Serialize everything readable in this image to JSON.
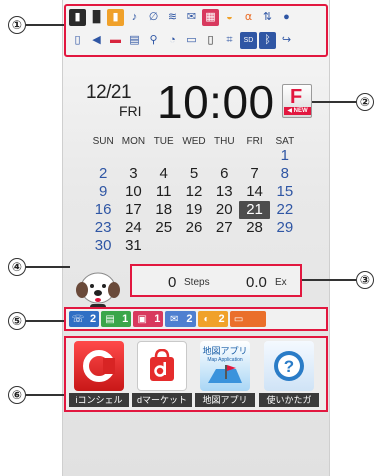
{
  "callouts": [
    "①",
    "②",
    "③",
    "④",
    "⑤",
    "⑥"
  ],
  "status_icons_row1": [
    "signal-icon",
    "antenna-icon",
    "battery-icon",
    "vibrate-icon",
    "silent-icon",
    "wifi-icon",
    "mail-icon",
    "calendar-icon",
    "omakase-lock-icon",
    "alarm-icon",
    "sync-icon",
    "bubble-icon"
  ],
  "status_icons_row2": [
    "sim-icon",
    "speaker-icon",
    "car-icon",
    "keyboard-icon",
    "walk-icon",
    "timer-icon",
    "card-icon",
    "battery-low-icon",
    "ir-icon",
    "sd-icon",
    "bluetooth-icon",
    "call-forward-icon"
  ],
  "clock": {
    "date": "12/21",
    "day": "FRI",
    "time": "10:00"
  },
  "f_badge": {
    "letter": "F",
    "new_label": "NEW"
  },
  "calendar": {
    "weekdays": [
      "SUN",
      "MON",
      "TUE",
      "WED",
      "THU",
      "FRI",
      "SAT"
    ],
    "weeks": [
      [
        "",
        "",
        "",
        "",
        "",
        "",
        "1"
      ],
      [
        "2",
        "3",
        "4",
        "5",
        "6",
        "7",
        "8"
      ],
      [
        "9",
        "10",
        "11",
        "12",
        "13",
        "14",
        "15"
      ],
      [
        "16",
        "17",
        "18",
        "19",
        "20",
        "21",
        "22"
      ],
      [
        "23",
        "24",
        "25",
        "26",
        "27",
        "28",
        "29"
      ],
      [
        "30",
        "31",
        "",
        "",
        "",
        "",
        ""
      ]
    ],
    "today": "21"
  },
  "steps": {
    "count": "0",
    "count_unit": "Steps",
    "ex": "0.0",
    "ex_unit": "Ex"
  },
  "notifications": [
    {
      "icon": "missed-call-icon",
      "count": "2",
      "color": "#2f6fc4"
    },
    {
      "icon": "voicemail-icon",
      "count": "1",
      "color": "#3aa64a"
    },
    {
      "icon": "sms-icon",
      "count": "1",
      "color": "#d8395e"
    },
    {
      "icon": "mail-icon",
      "count": "2",
      "color": "#4f7fd0"
    },
    {
      "icon": "news-icon",
      "count": "2",
      "color": "#f0a12a"
    },
    {
      "icon": "message-icon",
      "count": "",
      "color": "#ea6f2a"
    }
  ],
  "apps": [
    {
      "name": "iconcier-icon",
      "label": "iコンシェル",
      "color": "#e52c2c"
    },
    {
      "name": "dmarket-icon",
      "label": "dマーケット",
      "color": "#e52c2c"
    },
    {
      "name": "map-app-icon",
      "label": "地図アプリ",
      "color": "#4aa2e0",
      "tile_text": "地図アプリ",
      "tile_sub": "Map Application"
    },
    {
      "name": "guide-icon",
      "label": "使いかたガ",
      "color": "#2a7cc7"
    }
  ]
}
